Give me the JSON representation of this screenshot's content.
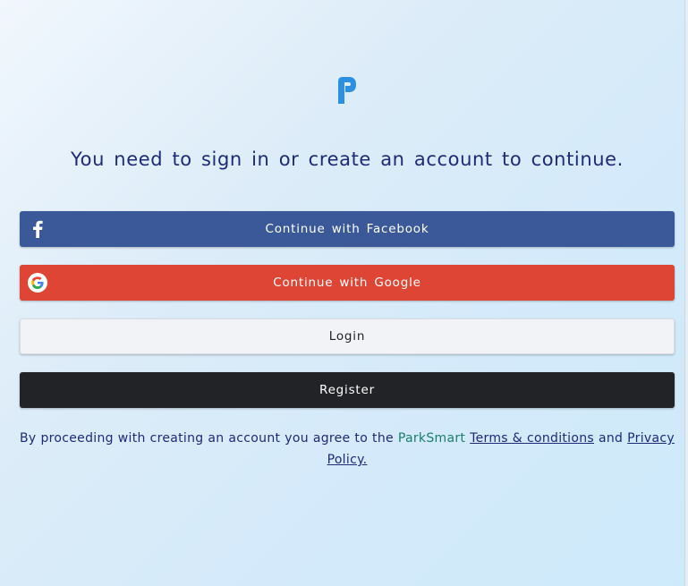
{
  "logo": {
    "icon": "parksmart-p-logo",
    "color": "#2d8fe0"
  },
  "heading": "You need to sign in or create an account to continue.",
  "buttons": {
    "facebook": {
      "label": "Continue with Facebook",
      "icon": "facebook-icon",
      "color": "#3b5998"
    },
    "google": {
      "label": "Continue with Google",
      "icon": "google-icon",
      "color": "#de4535"
    },
    "login": {
      "label": "Login",
      "color": "#f2f3f6"
    },
    "register": {
      "label": "Register",
      "color": "#222326"
    }
  },
  "consent": {
    "prefix": "By proceeding with creating an account you agree to the",
    "brand": "ParkSmart",
    "terms_link": "Terms & conditions",
    "and": "and",
    "privacy_link": "Privacy Policy",
    "suffix": "."
  }
}
